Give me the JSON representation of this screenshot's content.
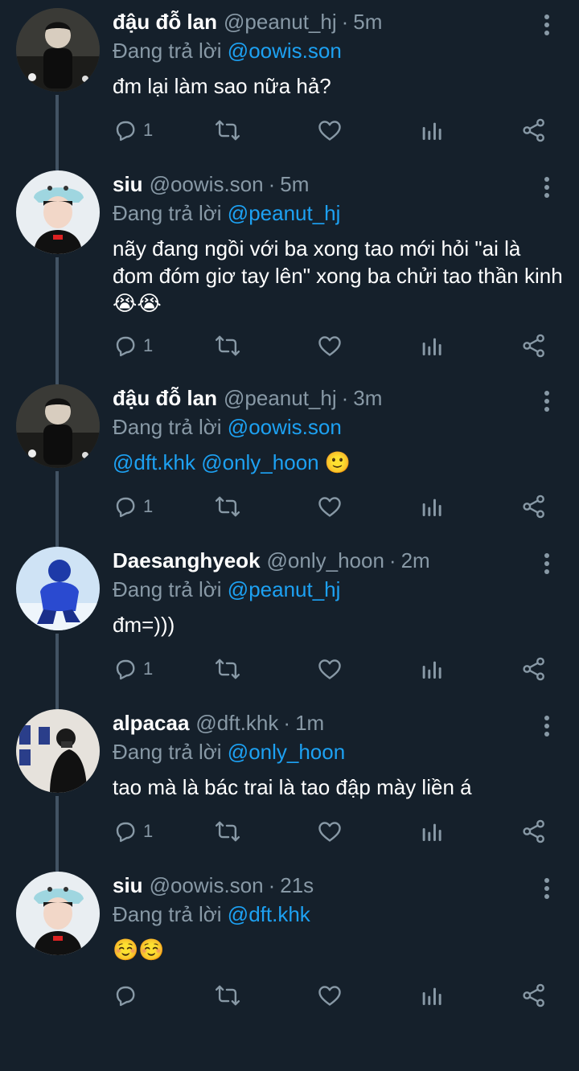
{
  "reply_prefix": "Đang trả lời",
  "tweets": [
    {
      "name": "đậu đỗ lan",
      "handle": "@peanut_hj",
      "time": "5m",
      "reply_to": "@oowis.son",
      "text": "đm lại làm sao nữa hả?",
      "reply_count": "1",
      "avatar": "person-dark-photo"
    },
    {
      "name": "siu",
      "handle": "@oowis.son",
      "time": "5m",
      "reply_to": "@peanut_hj",
      "text": "nãy đang ngồi với ba xong tao mới hỏi \"ai là đom đóm giơ tay lên\" xong ba chửi tao thần kinh",
      "emojis": [
        "😭",
        "😭"
      ],
      "reply_count": "1",
      "avatar": "person-bucket-hat"
    },
    {
      "name": "đậu đỗ lan",
      "handle": "@peanut_hj",
      "time": "3m",
      "reply_to": "@oowis.son",
      "mentions": [
        "@dft.khk",
        "@only_hoon"
      ],
      "emojis": [
        "🙂"
      ],
      "reply_count": "1",
      "avatar": "person-dark-photo"
    },
    {
      "name": "Daesanghyeok",
      "handle": "@only_hoon",
      "time": "2m",
      "reply_to": "@peanut_hj",
      "text": "đm=)))",
      "reply_count": "1",
      "avatar": "person-blue-snow"
    },
    {
      "name": "alpacaa",
      "handle": "@dft.khk",
      "time": "1m",
      "reply_to": "@only_hoon",
      "text": "tao mà là bác trai là tao đập mày liền á",
      "reply_count": "1",
      "avatar": "person-black-mask"
    },
    {
      "name": "siu",
      "handle": "@oowis.son",
      "time": "21s",
      "reply_to": "@dft.khk",
      "emojis": [
        "☺️",
        "☺️"
      ],
      "reply_count": "",
      "avatar": "person-bucket-hat"
    }
  ],
  "colors": {
    "background": "#15202b",
    "muted": "#8899a6",
    "link": "#1da1f2",
    "thread_line": "#425364"
  },
  "icons": [
    "reply-icon",
    "retweet-icon",
    "like-icon",
    "analytics-icon",
    "share-icon",
    "more-icon"
  ]
}
